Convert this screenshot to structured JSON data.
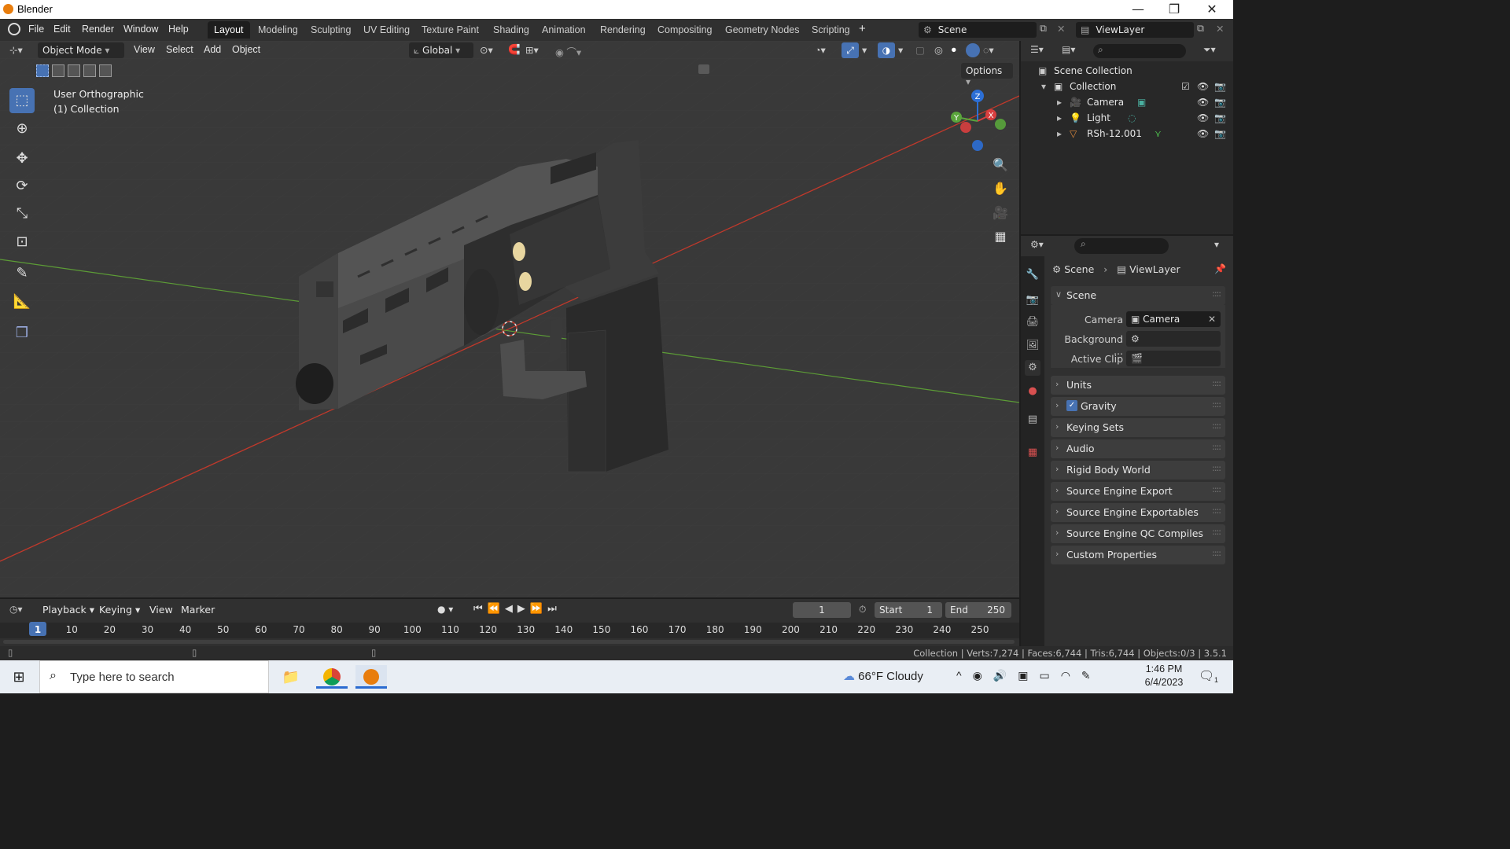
{
  "window": {
    "title": "Blender"
  },
  "menu": [
    "File",
    "Edit",
    "Render",
    "Window",
    "Help"
  ],
  "workspaces": [
    "Layout",
    "Modeling",
    "Sculpting",
    "UV Editing",
    "Texture Paint",
    "Shading",
    "Animation",
    "Rendering",
    "Compositing",
    "Geometry Nodes",
    "Scripting"
  ],
  "active_workspace": "Layout",
  "scene_name": "Scene",
  "view_layer": "ViewLayer",
  "viewport": {
    "mode": "Object Mode",
    "menus": [
      "View",
      "Select",
      "Add",
      "Object"
    ],
    "orientation": "Global",
    "options_label": "Options",
    "view_name": "User Orthographic",
    "collection_label": "(1) Collection",
    "axis_labels": {
      "x": "X",
      "y": "Y",
      "z": "Z"
    }
  },
  "outliner": {
    "root": "Scene Collection",
    "collection": "Collection",
    "items": [
      "Camera",
      "Light",
      "RSh-12.001"
    ]
  },
  "properties": {
    "breadcrumb_scene": "Scene",
    "breadcrumb_layer": "ViewLayer",
    "section": "Scene",
    "camera_label": "Camera",
    "camera_value": "Camera",
    "background_label": "Background ...",
    "active_clip_label": "Active Clip",
    "panels": [
      "Units",
      "Gravity",
      "Keying Sets",
      "Audio",
      "Rigid Body World",
      "Source Engine Export",
      "Source Engine Exportables",
      "Source Engine QC Compiles",
      "Custom Properties"
    ]
  },
  "timeline": {
    "menus": [
      "Playback",
      "Keying",
      "View",
      "Marker"
    ],
    "current_frame": "1",
    "start_label": "Start",
    "start": "1",
    "end_label": "End",
    "end": "250",
    "ticks": [
      "1",
      "10",
      "20",
      "30",
      "40",
      "50",
      "60",
      "70",
      "80",
      "90",
      "100",
      "110",
      "120",
      "130",
      "140",
      "150",
      "160",
      "170",
      "180",
      "190",
      "200",
      "210",
      "220",
      "230",
      "240",
      "250"
    ]
  },
  "status": {
    "text": "Collection | Verts:7,274 | Faces:6,744 | Tris:6,744 | Objects:0/3 | 3.5.1"
  },
  "taskbar": {
    "search_placeholder": "Type here to search",
    "weather": "66°F  Cloudy",
    "time": "1:46 PM",
    "date": "6/4/2023",
    "notifications": "1"
  }
}
